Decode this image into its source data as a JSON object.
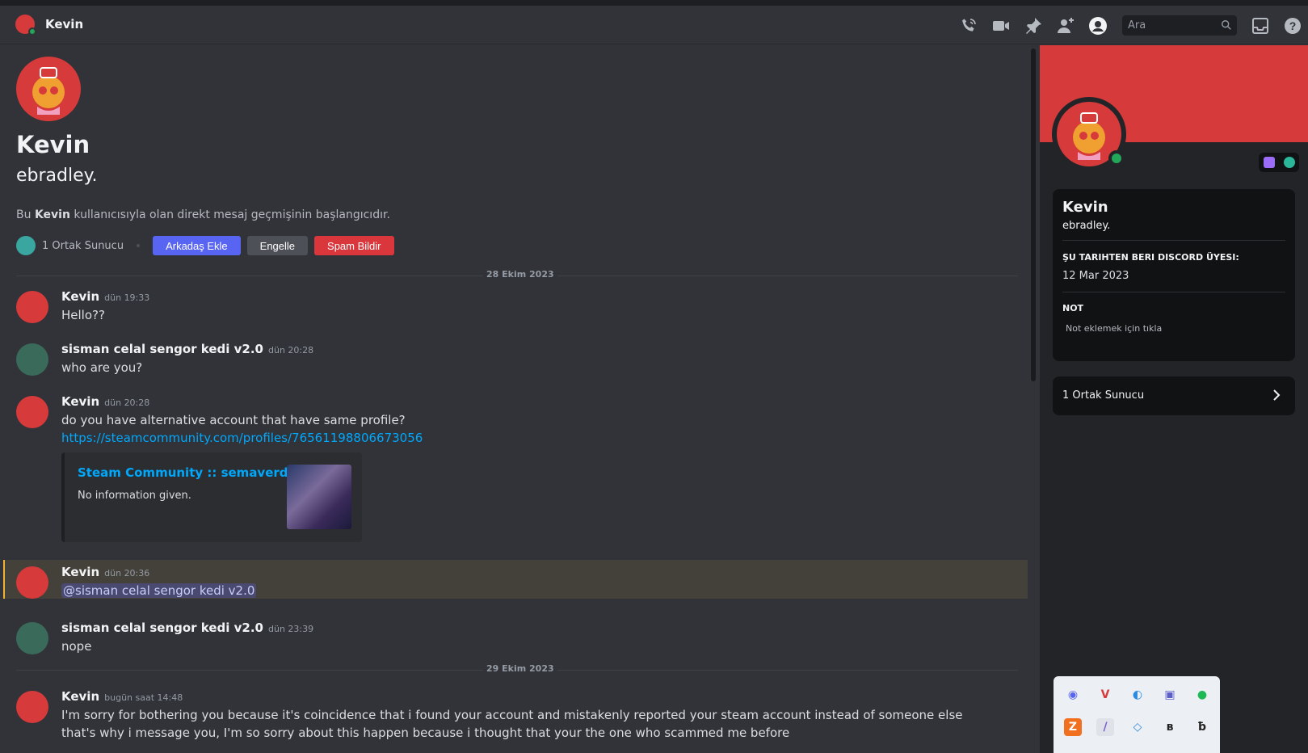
{
  "header": {
    "title": "Kevin",
    "search_placeholder": "Ara",
    "icons": [
      "phone-call-icon",
      "video-call-icon",
      "pin-icon",
      "add-friend-icon",
      "user-profile-icon",
      "search-icon",
      "inbox-icon",
      "help-icon"
    ]
  },
  "intro": {
    "display_name": "Kevin",
    "username": "ebradley.",
    "text_before": "Bu ",
    "text_bold": "Kevin",
    "text_after": " kullanıcısıyla olan direkt mesaj geçmişinin başlangıcıdır.",
    "mutual_servers": "1 Ortak Sunucu",
    "add_friend": "Arkadaş Ekle",
    "block": "Engelle",
    "report_spam": "Spam Bildir"
  },
  "dividers": [
    "28 Ekim 2023",
    "29 Ekim 2023"
  ],
  "messages": [
    {
      "author": "Kevin",
      "time": "dün 19:33",
      "text": "Hello??"
    },
    {
      "author": "sisman celal sengor kedi v2.0",
      "time": "dün 20:28",
      "text": "who are you?"
    },
    {
      "author": "Kevin",
      "time": "dün 20:28",
      "text": "do you have alternative account that have same profile?",
      "link": "https://steamcommunity.com/profiles/76561198806673056",
      "embed": {
        "title": "Steam Community :: semaverdecay",
        "description": "No information given."
      }
    },
    {
      "author": "Kevin",
      "time": "dün 20:36",
      "mention": "@sisman celal sengor kedi v2.0"
    },
    {
      "author": "sisman celal sengor kedi v2.0",
      "time": "dün 23:39",
      "text": "nope"
    },
    {
      "author": "Kevin",
      "time": "bugün saat 14:48",
      "text": "I'm sorry for bothering you because it's coincidence that i found your account and mistakenly reported your steam account instead of someone else that's why i message you, I'm so sorry about this happen because i thought that your the one who scammed me before"
    }
  ],
  "profile": {
    "display_name": "Kevin",
    "username": "ebradley.",
    "member_since_label": "ŞU TARIHTEN BERI DISCORD ÜYESI:",
    "member_since": "12 Mar 2023",
    "note_label": "NOT",
    "note_placeholder": "Not eklemek için tıkla",
    "mutual_servers": "1 Ortak Sunucu"
  },
  "colors": {
    "banner": "#d63a3a",
    "online": "#23a55a",
    "blurple": "#5865f2",
    "danger": "#da373c",
    "link": "#00a8fc"
  }
}
